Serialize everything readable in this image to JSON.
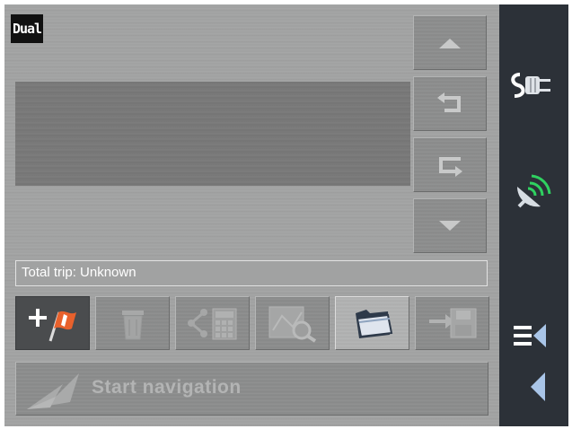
{
  "brand": {
    "logo_text": "Dual"
  },
  "route": {
    "total_trip": "Total trip: Unknown"
  },
  "actions": {
    "start_navigation": "Start navigation"
  },
  "icons": {
    "scroll_up": "triangle-up-icon",
    "back_arrow": "return-left-icon",
    "forward_arrow": "return-right-icon",
    "scroll_down": "triangle-down-icon",
    "add_waypoint": "add-flag-icon",
    "delete": "trash-icon",
    "route_calc": "route-calculator-icon",
    "map_search": "map-magnifier-icon",
    "open_folder": "folder-icon",
    "save_route": "save-disk-icon",
    "power": "power-plug-icon",
    "gps": "satellite-dish-icon",
    "menu": "menu-list-icon",
    "back": "back-triangle-icon"
  },
  "colors": {
    "accent_flag": "#e8612c",
    "rail": "#2c3138",
    "panel": "#7b7b7b"
  }
}
